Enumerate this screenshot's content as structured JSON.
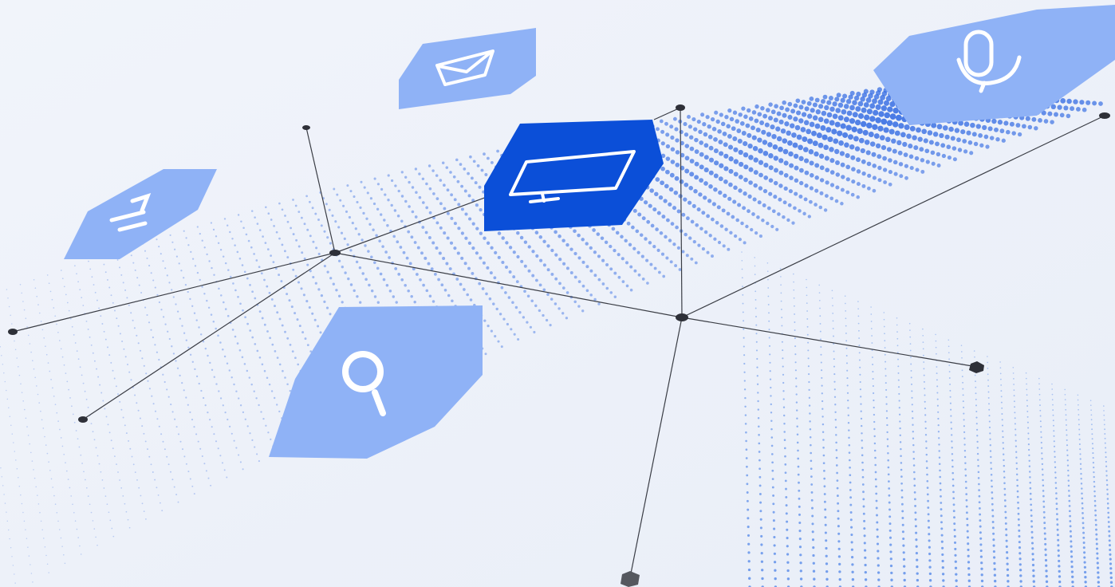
{
  "scene": {
    "background_color": "#eef2f9",
    "accent_color": "#0b4fd8",
    "tile_color": "#8fb2f6",
    "line_color": "#3a3d45",
    "node_color": "#2e3038"
  },
  "tiles": [
    {
      "icon": "mail-icon",
      "style": "light"
    },
    {
      "icon": "microphone-icon",
      "style": "light"
    },
    {
      "icon": "translate-icon",
      "style": "light"
    },
    {
      "icon": "monitor-icon",
      "style": "accent"
    },
    {
      "icon": "search-icon",
      "style": "light"
    }
  ]
}
